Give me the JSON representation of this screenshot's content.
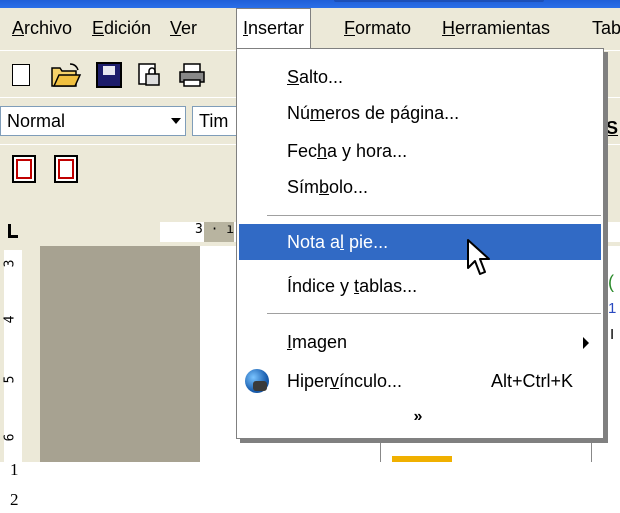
{
  "menubar": {
    "items": [
      {
        "label": "Archivo",
        "mnemonic_index": 0
      },
      {
        "label": "Edición",
        "mnemonic_index": 0
      },
      {
        "label": "Ver",
        "mnemonic_index": 0
      },
      {
        "label": "Insertar",
        "mnemonic_index": 0
      },
      {
        "label": "Formato",
        "mnemonic_index": 0
      },
      {
        "label": "Herramientas",
        "mnemonic_index": 0
      },
      {
        "label": "Tab",
        "mnemonic_index": -1
      }
    ],
    "active": "Insertar"
  },
  "toolbar_format": {
    "style_value": "Normal",
    "font_value": "Tim"
  },
  "ruler": {
    "top_number": "3 · ı",
    "left_numbers": [
      "3",
      "4",
      "5",
      "6"
    ]
  },
  "insert_menu": {
    "items": [
      {
        "label": "Salto...",
        "mnemonic": "S"
      },
      {
        "label": "Números de página...",
        "mnemonic": "m"
      },
      {
        "label": "Fecha y hora...",
        "mnemonic": "h"
      },
      {
        "label": "Símbolo...",
        "mnemonic": "b"
      },
      {
        "label": "Nota al pie...",
        "mnemonic": "l",
        "highlighted": true
      },
      {
        "label": "Índice y tablas...",
        "mnemonic": "t"
      },
      {
        "label": "Imagen",
        "mnemonic": "I",
        "has_submenu": true
      },
      {
        "label": "Hipervínculo...",
        "mnemonic": "v",
        "shortcut": "Alt+Ctrl+K",
        "icon": "globe-link-icon"
      }
    ],
    "expand_label": "»"
  },
  "right_side": {
    "letters": [
      "S",
      "(",
      "1",
      "I"
    ]
  },
  "below": {
    "lines": [
      "1",
      "2"
    ]
  },
  "colors": {
    "menu_highlight": "#316ac5",
    "chrome": "#ece9d8",
    "titlebar": "#2a6fe8"
  }
}
